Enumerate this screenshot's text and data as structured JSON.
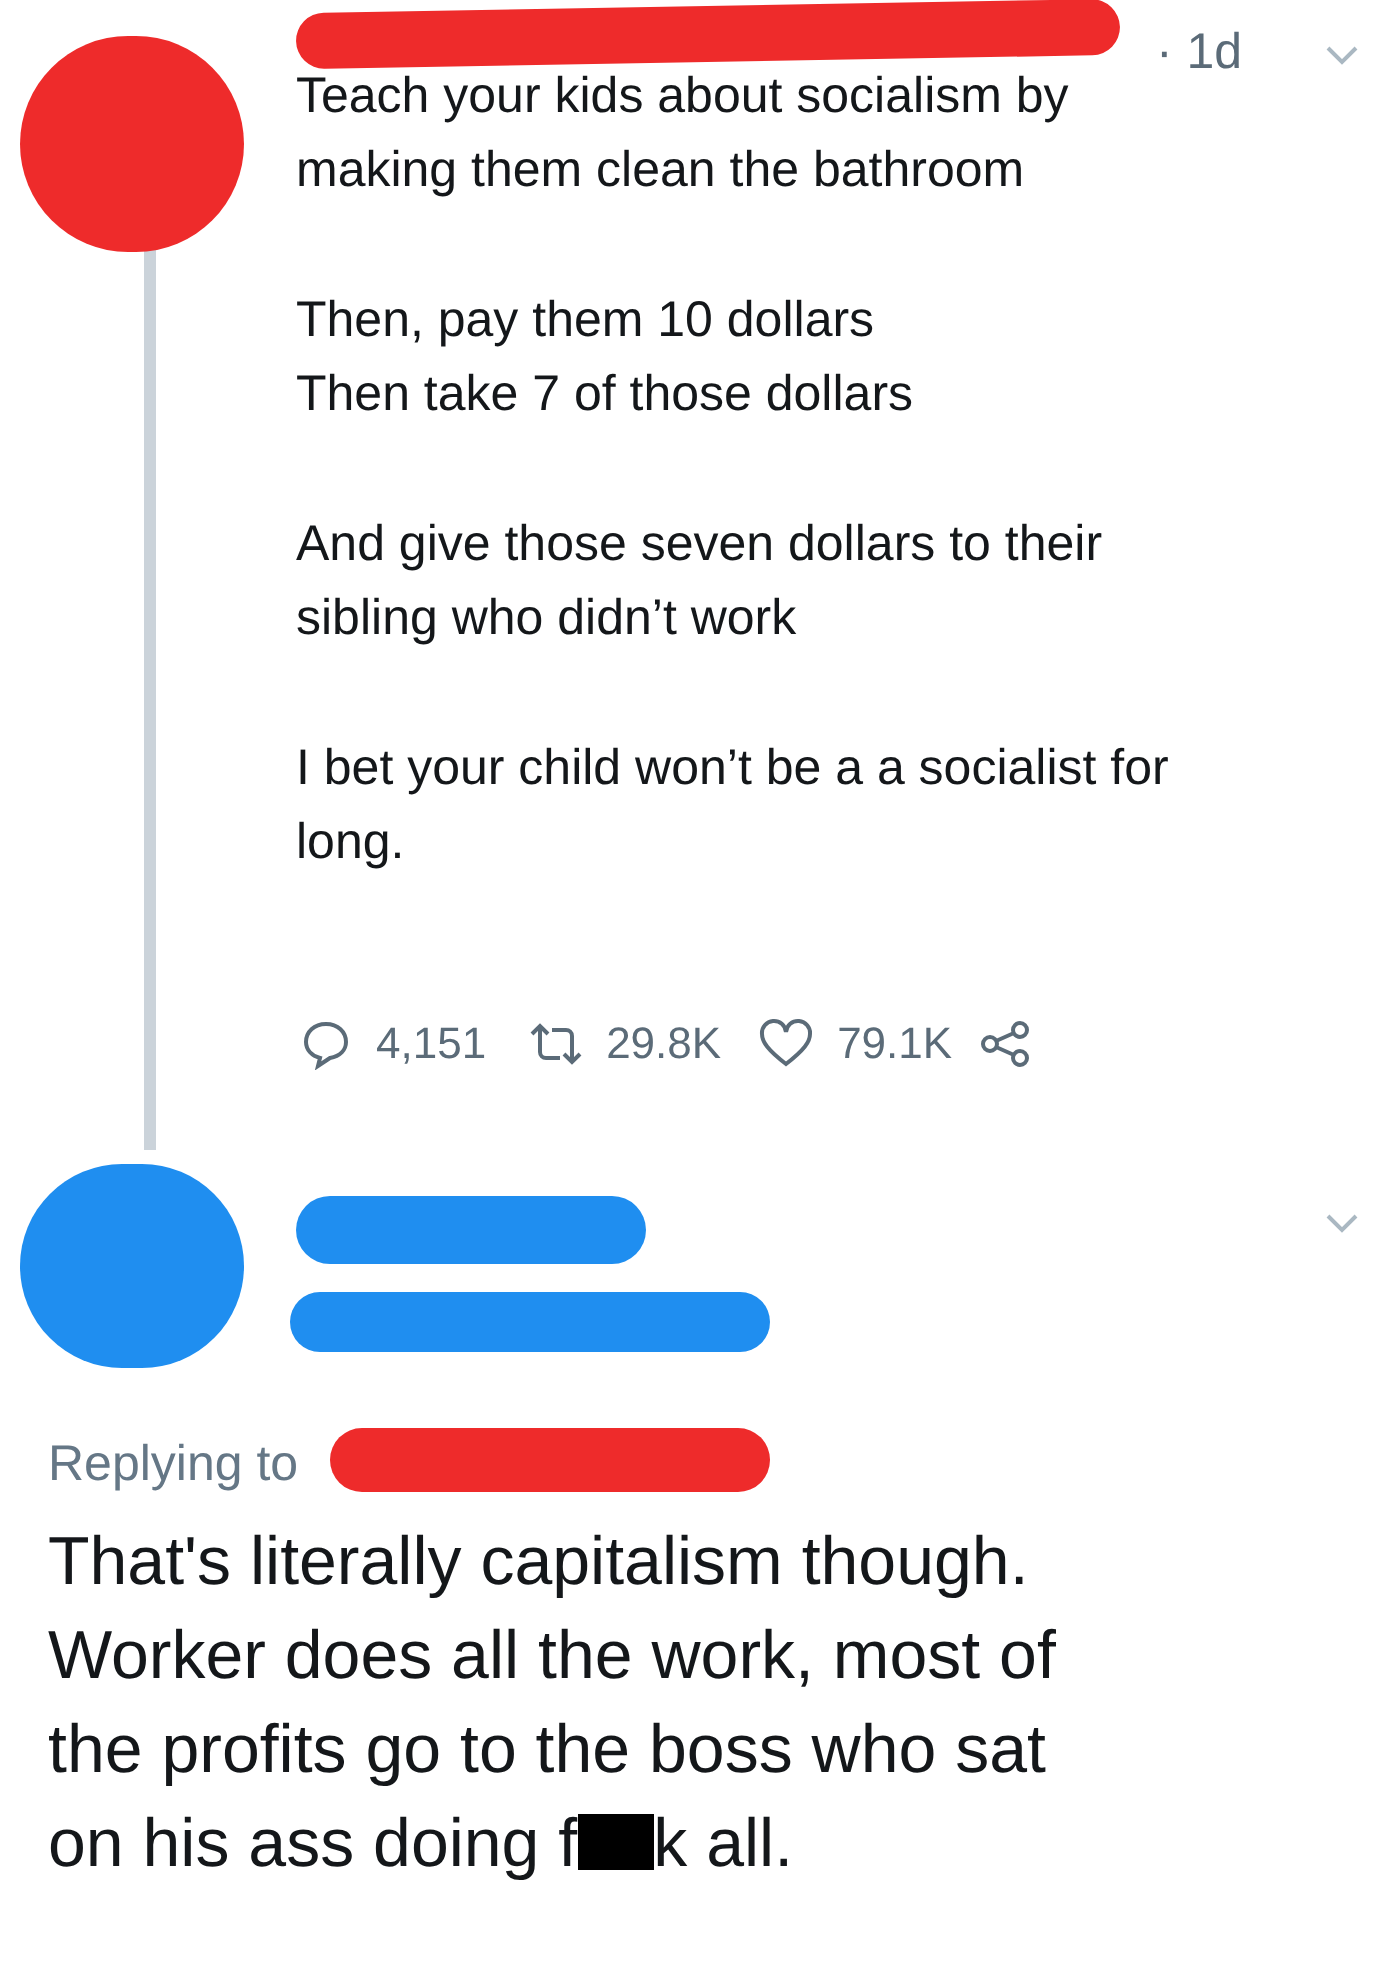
{
  "tweet": {
    "time": "· 1d",
    "paragraphs": [
      [
        "Teach your kids about socialism by",
        "making them clean the bathroom"
      ],
      [
        "Then, pay them 10 dollars",
        "Then take 7 of those dollars"
      ],
      [
        "And give those seven dollars to their",
        "sibling who didn’t work"
      ],
      [
        "I bet your child won’t be a a socialist for",
        "long."
      ]
    ],
    "replies": "4,151",
    "retweets": "29.8K",
    "likes": "79.1K"
  },
  "reply": {
    "replying_to": "Replying to",
    "lines": [
      "That's literally capitalism though.",
      "Worker does all the work, most of",
      "the profits go to the boss who sat"
    ],
    "last_line": {
      "before": "on his ass doing f",
      "after": "k all.",
      "censored": true
    }
  }
}
